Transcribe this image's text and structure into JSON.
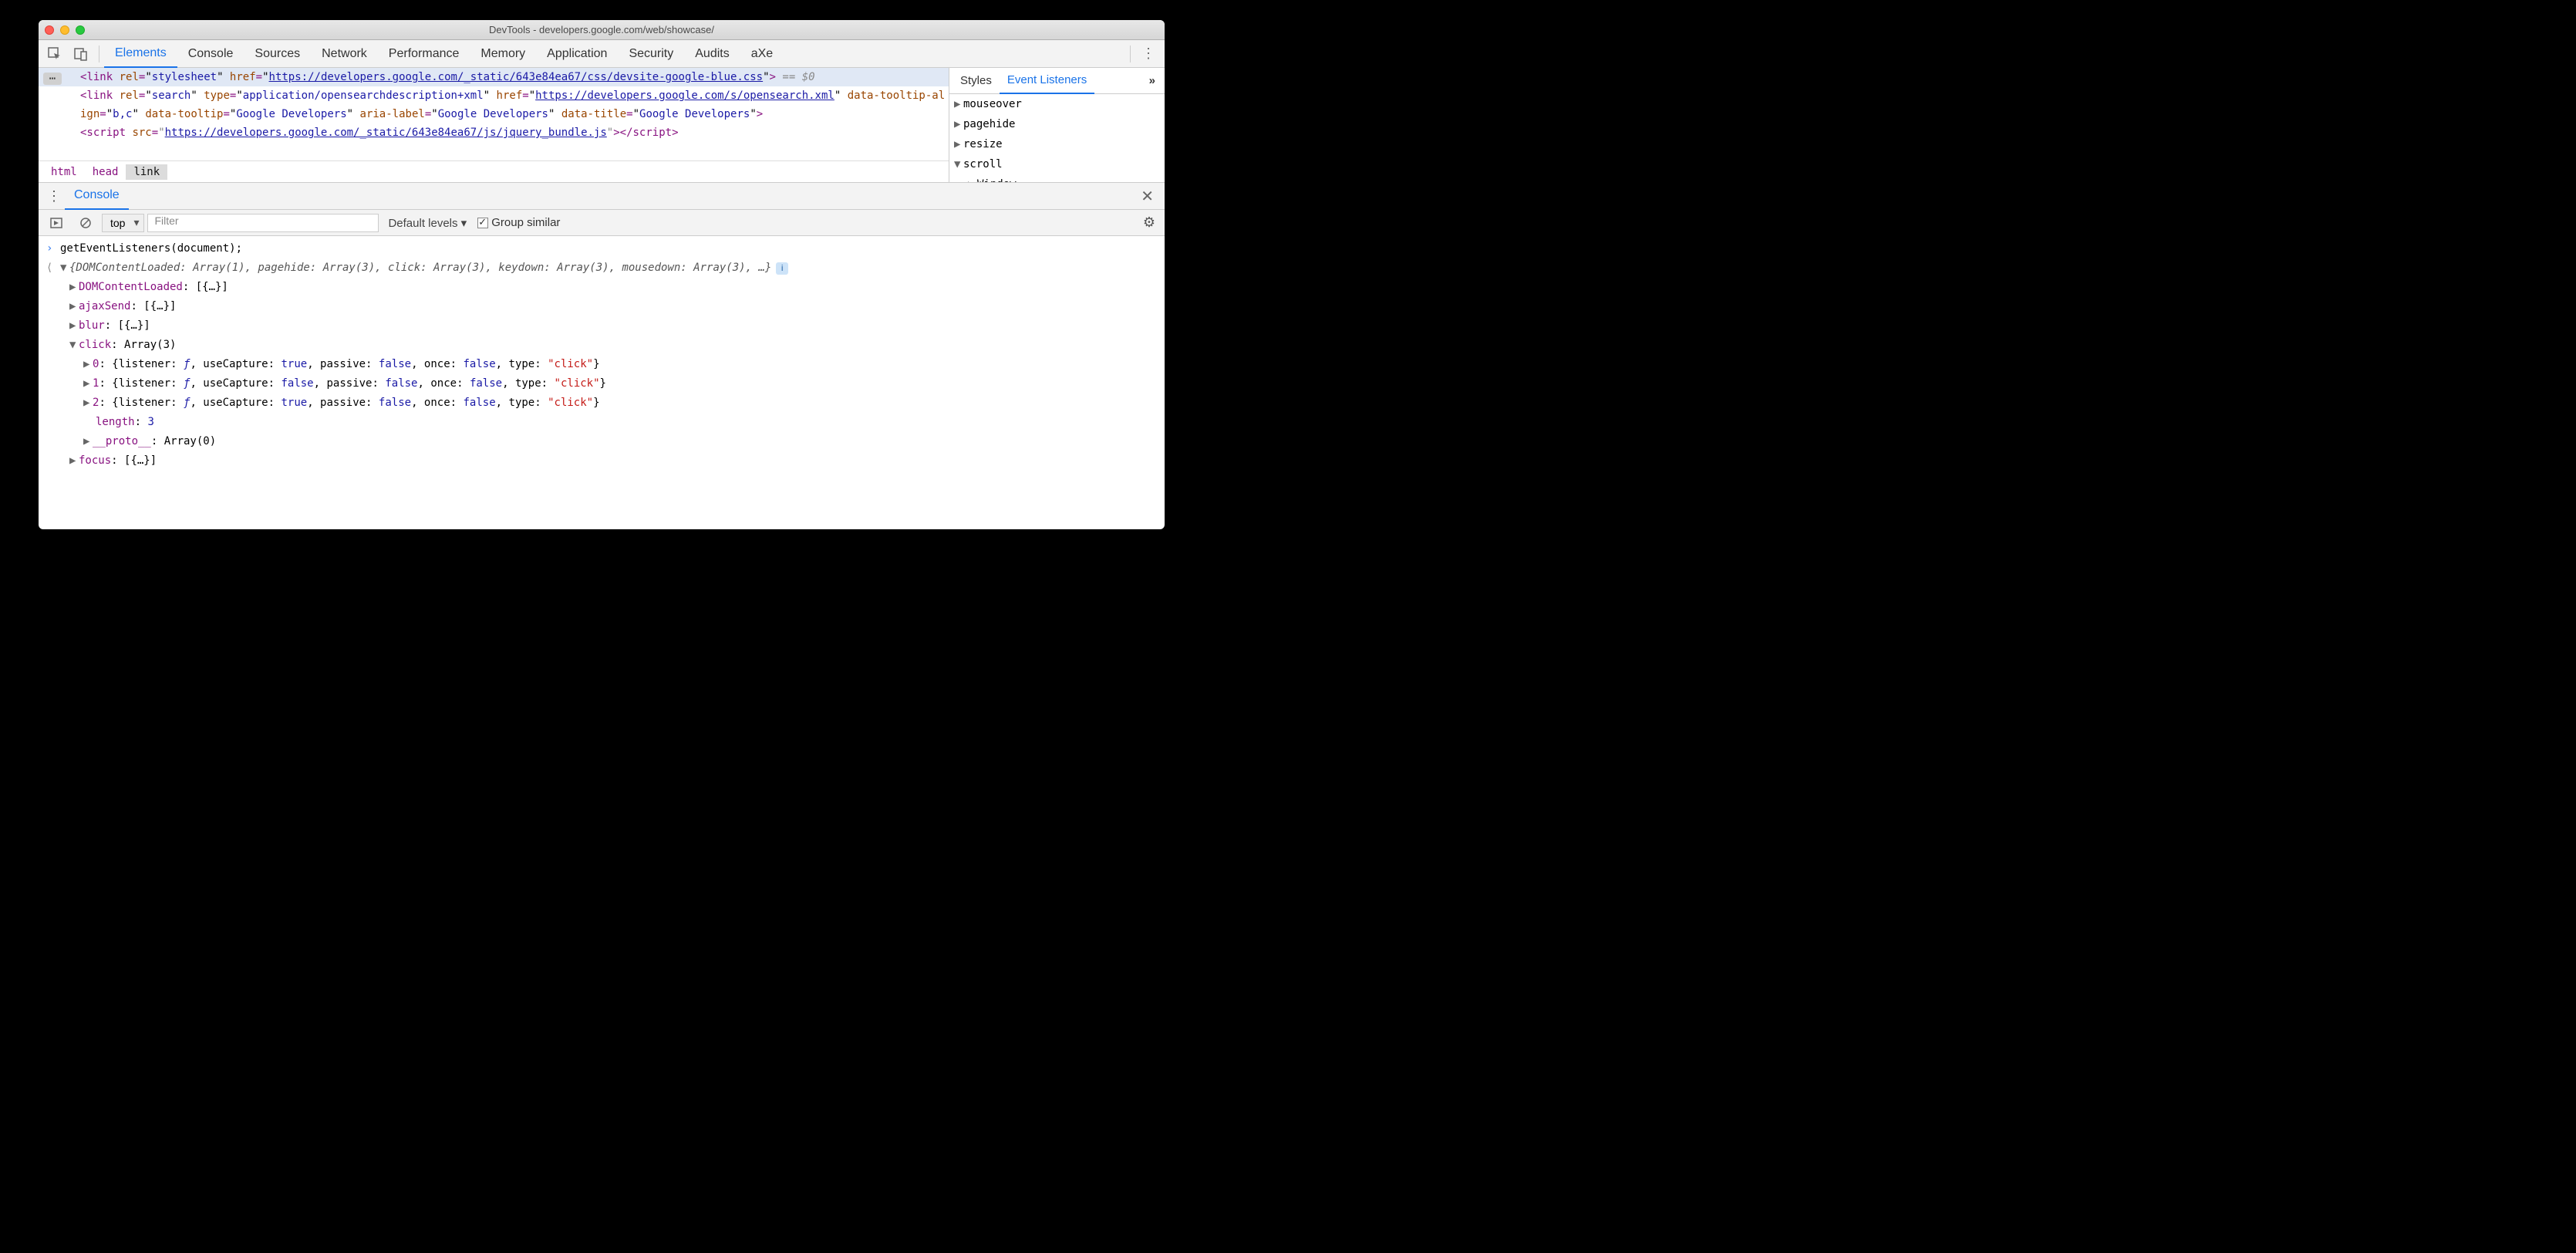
{
  "window": {
    "title": "DevTools - developers.google.com/web/showcase/"
  },
  "tabs": {
    "main": [
      "Elements",
      "Console",
      "Sources",
      "Network",
      "Performance",
      "Memory",
      "Application",
      "Security",
      "Audits",
      "aXe"
    ],
    "active": "Elements"
  },
  "dom": {
    "row1": {
      "tag": "link",
      "attrs": [
        {
          "n": "rel",
          "v": "stylesheet"
        },
        {
          "n": "href",
          "v": "https://developers.google.com/_static/643e84ea67/css/devsite-google-blue.css",
          "link": true
        }
      ],
      "suffix": "== $0",
      "selected": true
    },
    "row2": {
      "tag": "link",
      "attrs": [
        {
          "n": "rel",
          "v": "search"
        },
        {
          "n": "type",
          "v": "application/opensearchdescription+xml"
        },
        {
          "n": "href",
          "v": "https://developers.google.com/s/opensearch.xml",
          "link": true
        },
        {
          "n": "data-tooltip-align",
          "v": "b,c"
        },
        {
          "n": "data-tooltip",
          "v": "Google Developers"
        },
        {
          "n": "aria-label",
          "v": "Google Developers"
        },
        {
          "n": "data-title",
          "v": "Google Developers"
        }
      ]
    },
    "row3": {
      "raw": "<script src=\"https://developers.google.com/_static/643e84ea67/js/jquery_bundle.js\"></script>"
    }
  },
  "breadcrumbs": [
    "html",
    "head",
    "link"
  ],
  "side": {
    "tabs": [
      "Styles",
      "Event Listeners"
    ],
    "active": "Event Listeners",
    "events": [
      {
        "label": "mouseover",
        "open": false
      },
      {
        "label": "pagehide",
        "open": false
      },
      {
        "label": "resize",
        "open": false
      },
      {
        "label": "scroll",
        "open": true,
        "children": [
          {
            "label": "Window"
          }
        ]
      }
    ]
  },
  "drawer": {
    "tab": "Console"
  },
  "console_toolbar": {
    "context": "top",
    "filter_placeholder": "Filter",
    "levels": "Default levels ▾",
    "group_similar": "Group similar"
  },
  "console": {
    "input": "getEventListeners(document);",
    "summary": "{DOMContentLoaded: Array(1), pagehide: Array(3), click: Array(3), keydown: Array(3), mousedown: Array(3), …}",
    "lines": [
      {
        "tri": "▶",
        "label": "DOMContentLoaded",
        "val": "[{…}]"
      },
      {
        "tri": "▶",
        "label": "ajaxSend",
        "val": "[{…}]"
      },
      {
        "tri": "▶",
        "label": "blur",
        "val": "[{…}]"
      },
      {
        "tri": "▼",
        "label": "click",
        "val": "Array(3)"
      }
    ],
    "click_items": [
      {
        "idx": "0",
        "useCapture": "true",
        "passive": "false",
        "once": "false",
        "type": "\"click\""
      },
      {
        "idx": "1",
        "useCapture": "false",
        "passive": "false",
        "once": "false",
        "type": "\"click\""
      },
      {
        "idx": "2",
        "useCapture": "true",
        "passive": "false",
        "once": "false",
        "type": "\"click\""
      }
    ],
    "length_label": "length",
    "length_val": "3",
    "proto_label": "__proto__",
    "proto_val": "Array(0)",
    "focus": {
      "tri": "▶",
      "label": "focus",
      "val": "[{…}]"
    }
  }
}
